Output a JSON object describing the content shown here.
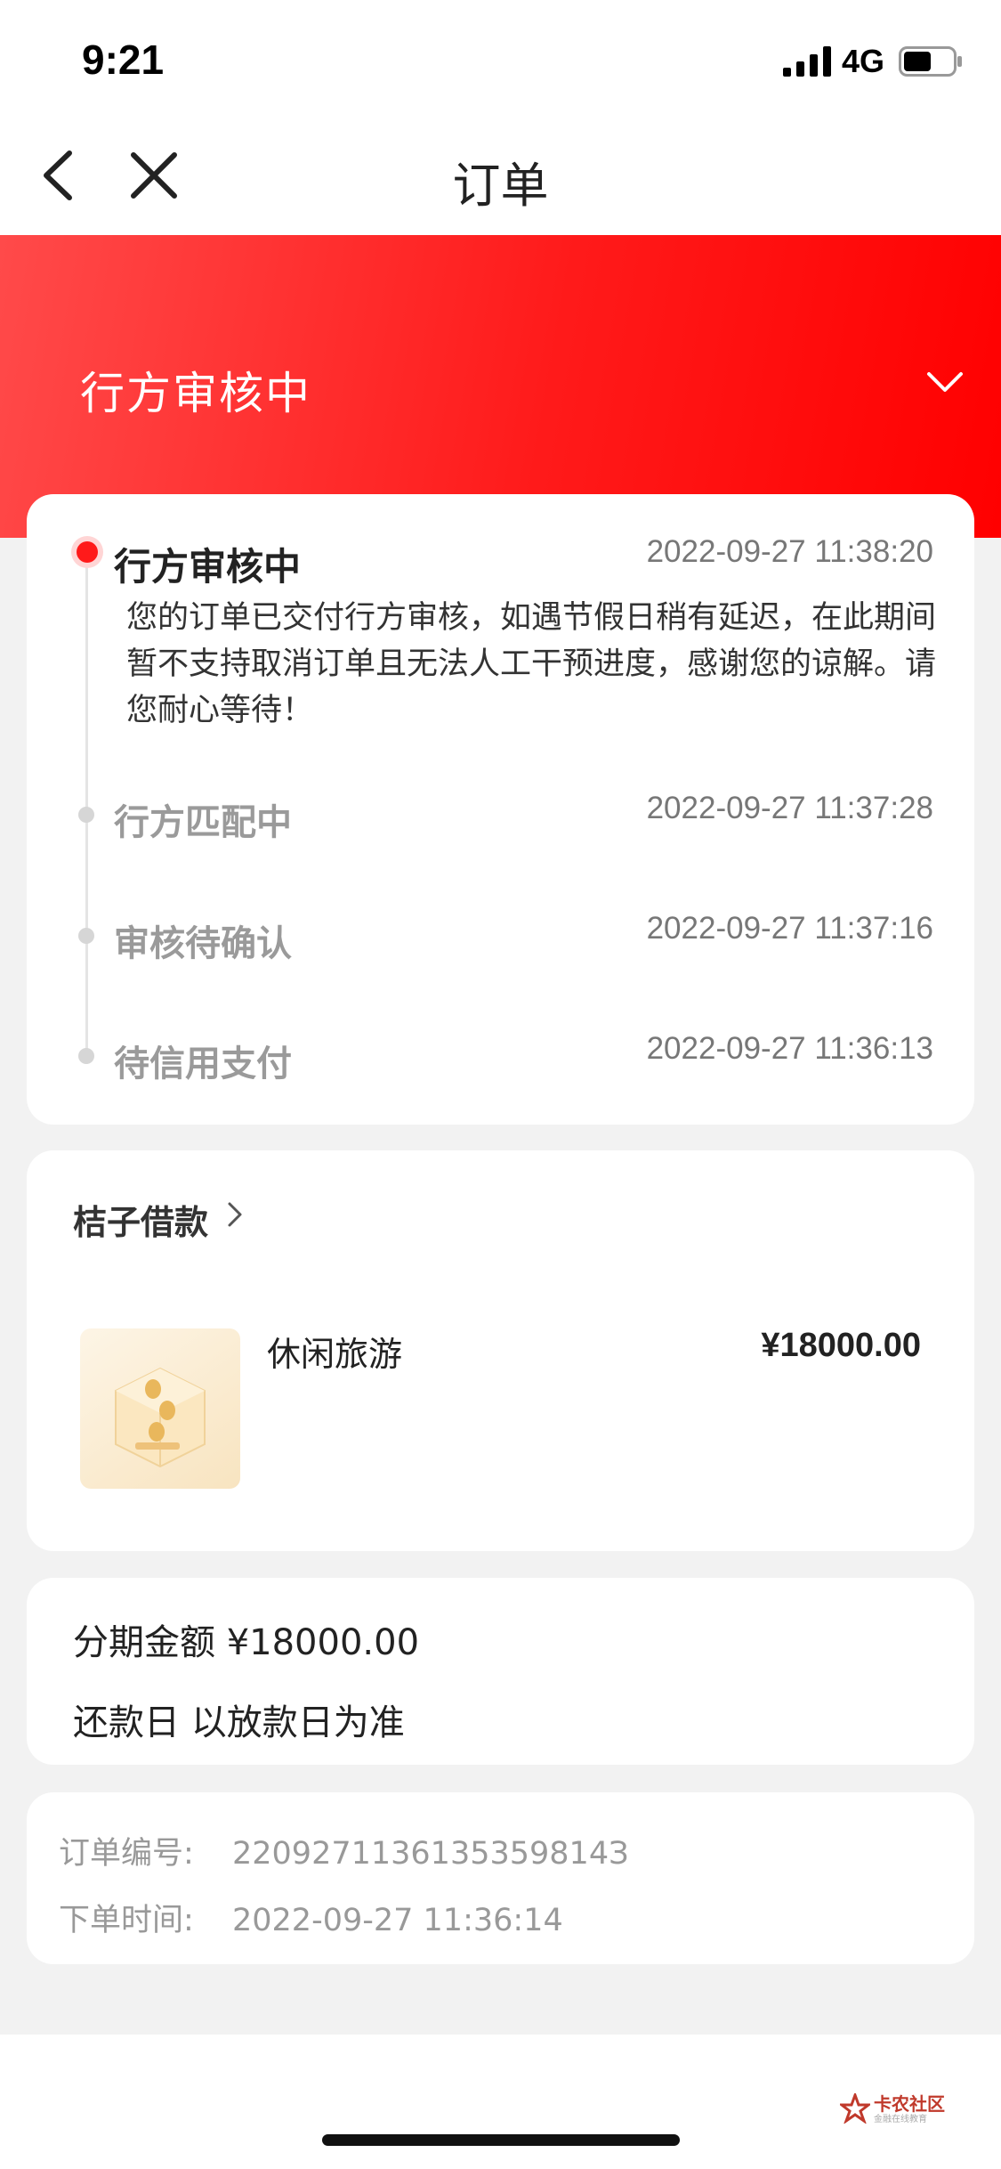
{
  "status_bar": {
    "time": "9:21",
    "network": "4G"
  },
  "nav": {
    "title": "订单"
  },
  "header": {
    "status": "行方审核中"
  },
  "timeline": [
    {
      "title": "行方审核中",
      "time": "2022-09-27 11:38:20",
      "active": true,
      "description": "您的订单已交付行方审核，如遇节假日稍有延迟，在此期间暂不支持取消订单且无法人工干预进度，感谢您的谅解。请您耐心等待！"
    },
    {
      "title": "行方匹配中",
      "time": "2022-09-27 11:37:28"
    },
    {
      "title": "审核待确认",
      "time": "2022-09-27 11:37:16"
    },
    {
      "title": "待信用支付",
      "time": "2022-09-27 11:36:13"
    }
  ],
  "product": {
    "merchant": "桔子借款",
    "name": "休闲旅游",
    "price": "¥18000.00"
  },
  "installment": {
    "amount": "分期金额 ¥18000.00",
    "repayment": "还款日 以放款日为准"
  },
  "order": {
    "number_label": "订单编号:",
    "number": "2209271136135359814З",
    "time_label": "下单时间:",
    "time": "2022-09-27 11:36:14"
  },
  "watermark": {
    "name": "卡农社区",
    "sub": "金融在线教育"
  },
  "colors": {
    "accent": "#ff1a1a",
    "background": "#f2f2f2"
  }
}
